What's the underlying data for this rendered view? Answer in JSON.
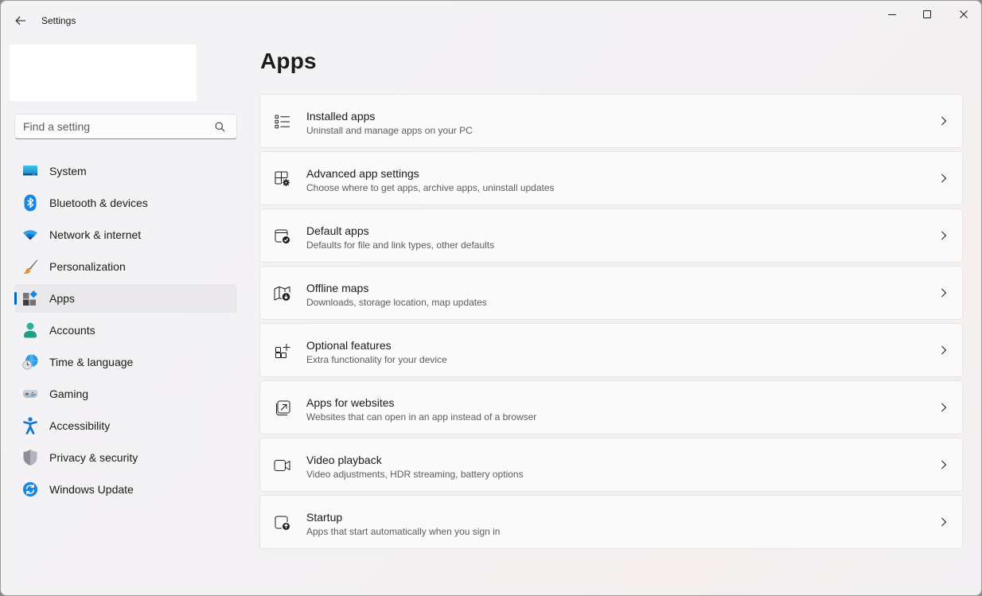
{
  "window": {
    "title": "Settings"
  },
  "search": {
    "placeholder": "Find a setting",
    "value": ""
  },
  "sidebar": {
    "items": [
      {
        "label": "System",
        "icon": "monitor-icon",
        "active": false
      },
      {
        "label": "Bluetooth & devices",
        "icon": "bluetooth-icon",
        "active": false
      },
      {
        "label": "Network & internet",
        "icon": "wifi-icon",
        "active": false
      },
      {
        "label": "Personalization",
        "icon": "paintbrush-icon",
        "active": false
      },
      {
        "label": "Apps",
        "icon": "apps-icon",
        "active": true
      },
      {
        "label": "Accounts",
        "icon": "person-icon",
        "active": false
      },
      {
        "label": "Time & language",
        "icon": "globe-clock-icon",
        "active": false
      },
      {
        "label": "Gaming",
        "icon": "gamepad-icon",
        "active": false
      },
      {
        "label": "Accessibility",
        "icon": "accessibility-icon",
        "active": false
      },
      {
        "label": "Privacy & security",
        "icon": "shield-icon",
        "active": false
      },
      {
        "label": "Windows Update",
        "icon": "update-icon",
        "active": false
      }
    ]
  },
  "main": {
    "title": "Apps",
    "cards": [
      {
        "title": "Installed apps",
        "description": "Uninstall and manage apps on your PC",
        "icon": "list-icon"
      },
      {
        "title": "Advanced app settings",
        "description": "Choose where to get apps, archive apps, uninstall updates",
        "icon": "app-settings-icon"
      },
      {
        "title": "Default apps",
        "description": "Defaults for file and link types, other defaults",
        "icon": "default-apps-icon"
      },
      {
        "title": "Offline maps",
        "description": "Downloads, storage location, map updates",
        "icon": "map-download-icon"
      },
      {
        "title": "Optional features",
        "description": "Extra functionality for your device",
        "icon": "add-grid-icon"
      },
      {
        "title": "Apps for websites",
        "description": "Websites that can open in an app instead of a browser",
        "icon": "open-in-app-icon"
      },
      {
        "title": "Video playback",
        "description": "Video adjustments, HDR streaming, battery options",
        "icon": "video-icon"
      },
      {
        "title": "Startup",
        "description": "Apps that start automatically when you sign in",
        "icon": "startup-icon"
      }
    ]
  },
  "colors": {
    "accent": "#0067c0",
    "active_nav_bg": "#eae8ea"
  }
}
